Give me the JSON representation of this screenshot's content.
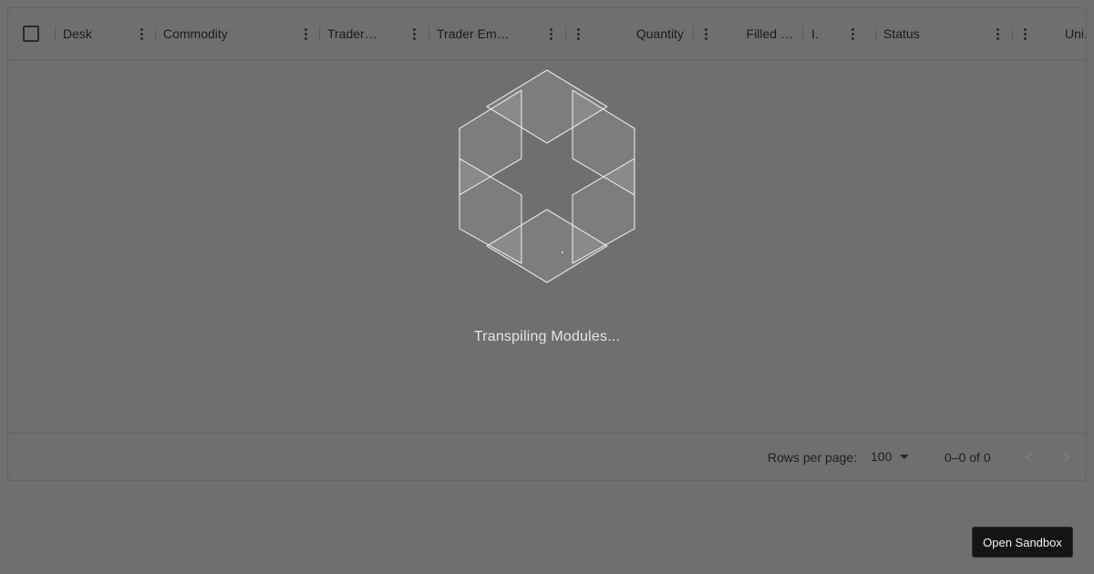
{
  "grid": {
    "columns": [
      {
        "key": "desk",
        "label": "Desk"
      },
      {
        "key": "commodity",
        "label": "Commodity"
      },
      {
        "key": "trader_name",
        "label": "Trader…"
      },
      {
        "key": "trader_email",
        "label": "Trader Em…"
      },
      {
        "key": "quantity",
        "label": "Quantity"
      },
      {
        "key": "filled_quantity",
        "label": "Filled …"
      },
      {
        "key": "is_filled",
        "label": "I."
      },
      {
        "key": "status",
        "label": "Status"
      },
      {
        "key": "unit_price",
        "label": "Uni."
      }
    ]
  },
  "loading": {
    "message": "Transpiling Modules..."
  },
  "footer": {
    "rows_per_page_label": "Rows per page:",
    "rows_per_page_value": "100",
    "range_text": "0–0 of 0"
  },
  "sandbox": {
    "button_label": "Open Sandbox"
  },
  "colors": {
    "overlay": "#6f6f6f",
    "button": "#151515",
    "loader_stroke": "#e6e6e6"
  }
}
